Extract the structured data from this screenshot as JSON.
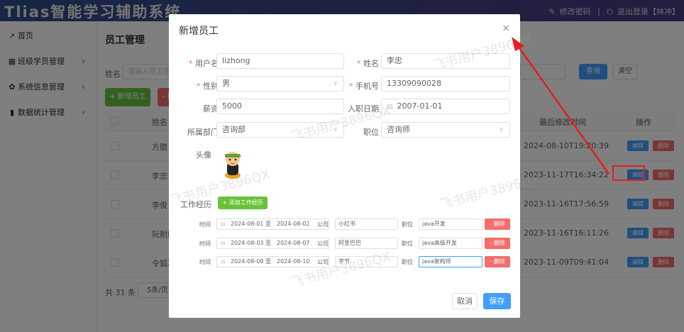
{
  "app": {
    "title": "Tlias智能学习辅助系统",
    "change_password": "修改密码",
    "separator": "|",
    "logout": "退出登录【林冲】"
  },
  "sidebar": {
    "items": [
      {
        "icon": "send-icon",
        "label": "首页"
      },
      {
        "icon": "grid-icon",
        "label": "班级学员管理"
      },
      {
        "icon": "gear-icon",
        "label": "系统信息管理"
      },
      {
        "icon": "bar-chart-icon",
        "label": "数据统计管理"
      }
    ]
  },
  "page": {
    "title": "员工管理",
    "filter_name_label": "姓名",
    "filter_name_placeholder": "请输入员工姓名",
    "add_button": "+ 新增员工",
    "batch_delete_button": "- 批",
    "query_button": "查询",
    "clear_button": "清空",
    "columns": {
      "name": "姓名",
      "update_time": "最后修改时间",
      "actions": "操作"
    },
    "rows": [
      {
        "name": "方腊",
        "update_time": "2024-08-10T19:20:39"
      },
      {
        "name": "李忠",
        "update_time": "2023-11-17T16:34:22"
      },
      {
        "name": "李俊",
        "update_time": "2023-11-16T17:56:59"
      },
      {
        "name": "阮耐庵",
        "update_time": "2023-11-16T16:11:26"
      },
      {
        "name": "令狐冲",
        "update_time": "2023-11-09T09:41:04"
      }
    ],
    "edit_label": "编辑",
    "delete_label": "删除",
    "total": "共 31 条",
    "page_size": "5条/页"
  },
  "dialog": {
    "title": "新增员工",
    "close": "×",
    "fields": {
      "username_label": "用户名",
      "username_value": "lizhong",
      "name_label": "姓名",
      "name_value": "李忠",
      "gender_label": "性别",
      "gender_value": "男",
      "phone_label": "手机号",
      "phone_value": "13309090028",
      "salary_label": "薪资",
      "salary_value": "5000",
      "entry_date_label": "入职日期",
      "entry_date_value": "2007-01-01",
      "dept_label": "所属部门",
      "dept_value": "咨询部",
      "job_label": "职位",
      "job_value": "咨询师",
      "avatar_label": "头像",
      "experience_label": "工作经历"
    },
    "required_mark": "*",
    "add_experience_button": "+ 添加工作经历",
    "experience_time_label": "时间",
    "experience_company_label": "公司",
    "experience_job_label": "职位",
    "experience_to": "至",
    "experience_delete": "- 删除",
    "experiences": [
      {
        "begin": "2024-08-01",
        "end": "2024-08-02",
        "company": "小红书",
        "job": "java开发"
      },
      {
        "begin": "2024-08-03",
        "end": "2024-08-07",
        "company": "阿里巴巴",
        "job": "java高级开发"
      },
      {
        "begin": "2024-08-08",
        "end": "2024-08-10",
        "company": "字节",
        "job": "java架构师"
      }
    ],
    "cancel_button": "取消",
    "save_button": "保存"
  },
  "watermark": "飞书用户3896QX",
  "colors": {
    "primary": "#409eff",
    "success": "#67c23a",
    "danger": "#f56c6c",
    "annotation": "#e02020"
  }
}
